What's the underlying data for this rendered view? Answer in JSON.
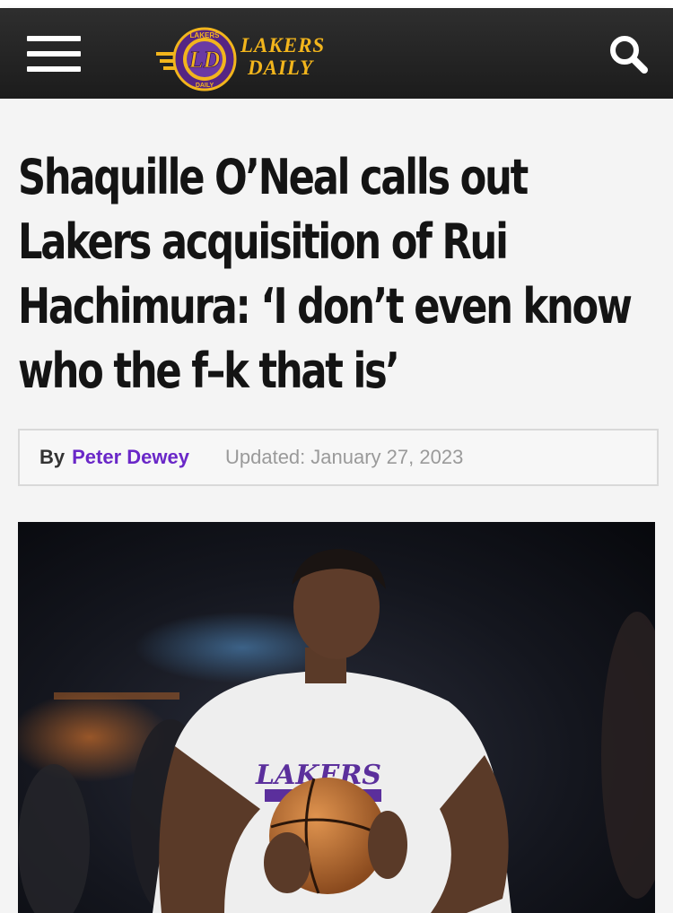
{
  "header": {
    "logo_monogram": "LD",
    "logo_badge_top": "LAKERS",
    "logo_badge_bottom": "DAILY",
    "logo_line1": "LAKERS",
    "logo_line2": "DAILY"
  },
  "article": {
    "headline": "Shaquille O’Neal calls out Lakers acquisition of Rui Hachimura: ‘I don’t even know who the f–k that is’",
    "by_label": "By",
    "author": "Peter Dewey",
    "updated_label": "Updated:",
    "updated_date": "January 27, 2023",
    "photo": {
      "jersey_text": "LAKERS"
    }
  },
  "colors": {
    "header_bg": "#242424",
    "brand_gold": "#f2b51c",
    "brand_purple": "#552583",
    "author_link": "#6a27c8"
  },
  "icons": [
    "hamburger-menu-icon",
    "search-icon"
  ]
}
